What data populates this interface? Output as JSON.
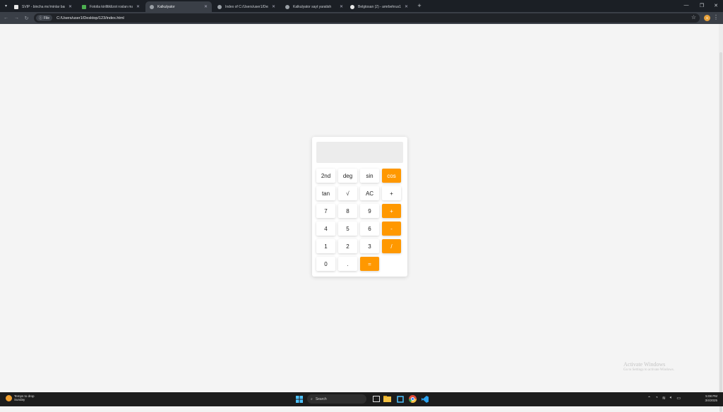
{
  "browser": {
    "tabs": [
      {
        "title": "SVIP - bincha mo'minlar barc..."
      },
      {
        "title": "Fotolia kirilltiklizot roslan ma..."
      },
      {
        "title": "Kalkulyator"
      },
      {
        "title": "Index of C:/Users/user1/Deskt..."
      },
      {
        "title": "Kalkulyator sayt yaratish"
      },
      {
        "title": "Belgtosan (2) - amrbehrus1..."
      }
    ],
    "address": {
      "chip": "File",
      "url": "C:/Users/user1/Desktop/123/index.html"
    },
    "profile_initial": "s"
  },
  "calculator": {
    "display_value": "",
    "keys": [
      {
        "label": "2nd",
        "type": "func"
      },
      {
        "label": "deg",
        "type": "func"
      },
      {
        "label": "sin",
        "type": "func"
      },
      {
        "label": "cos",
        "type": "op"
      },
      {
        "label": "tan",
        "type": "func"
      },
      {
        "label": "√",
        "type": "func"
      },
      {
        "label": "AC",
        "type": "func"
      },
      {
        "label": "+",
        "type": "func"
      },
      {
        "label": "7",
        "type": "num"
      },
      {
        "label": "8",
        "type": "num"
      },
      {
        "label": "9",
        "type": "num"
      },
      {
        "label": "+",
        "type": "op"
      },
      {
        "label": "4",
        "type": "num"
      },
      {
        "label": "5",
        "type": "num"
      },
      {
        "label": "6",
        "type": "num"
      },
      {
        "label": "-",
        "type": "op"
      },
      {
        "label": "1",
        "type": "num"
      },
      {
        "label": "2",
        "type": "num"
      },
      {
        "label": "3",
        "type": "num"
      },
      {
        "label": "/",
        "type": "op"
      },
      {
        "label": "0",
        "type": "num"
      },
      {
        "label": ".",
        "type": "num"
      },
      {
        "label": "=",
        "type": "op"
      }
    ]
  },
  "watermark": {
    "line1": "Activate Windows",
    "line2": "Go to Settings to activate Windows."
  },
  "taskbar": {
    "weather_line1": "Temps to drop",
    "weather_line2": "Sunday",
    "search_placeholder": "Search",
    "time": "5:08 PM",
    "date": "3/4/2025"
  },
  "colors": {
    "accent": "#ff9800",
    "display_bg": "#ececec",
    "page_bg": "#f4f4f4"
  }
}
